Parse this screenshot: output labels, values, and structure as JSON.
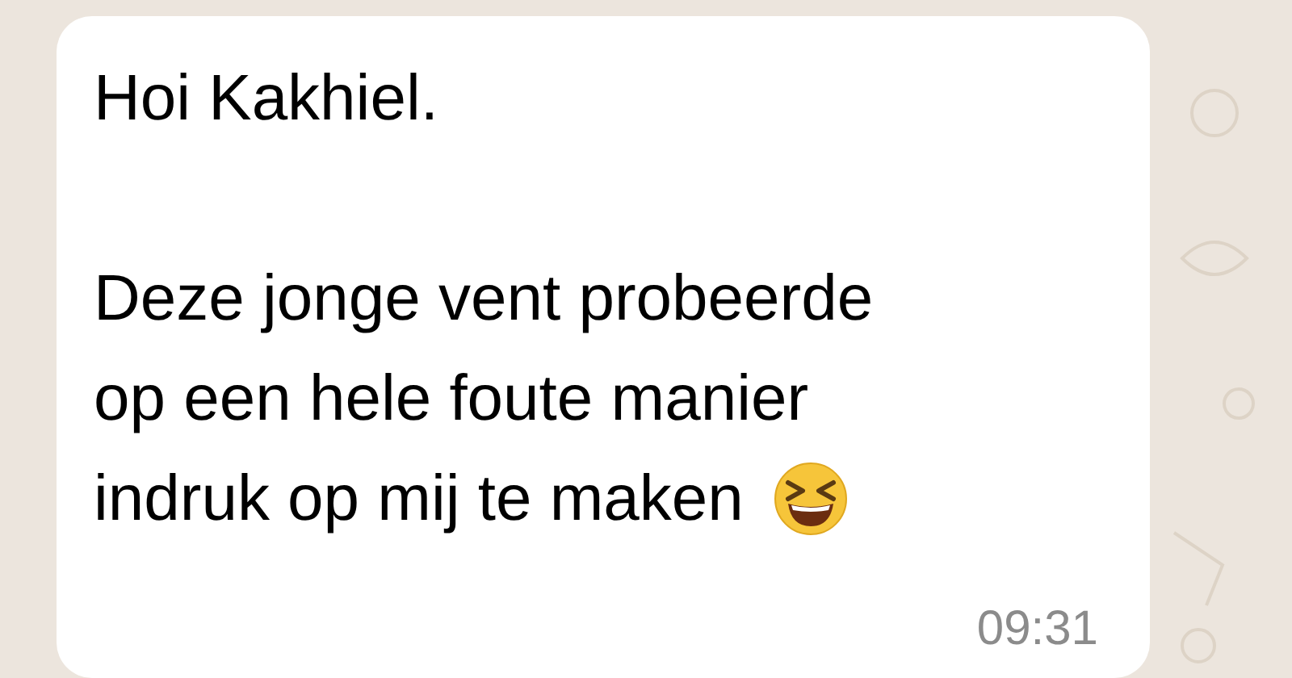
{
  "message": {
    "greeting": "Hoi Kakhiel.",
    "lines": [
      "Deze jonge vent probeerde",
      "op een hele foute manier",
      "indruk op mij te maken"
    ],
    "time": "09:31"
  }
}
